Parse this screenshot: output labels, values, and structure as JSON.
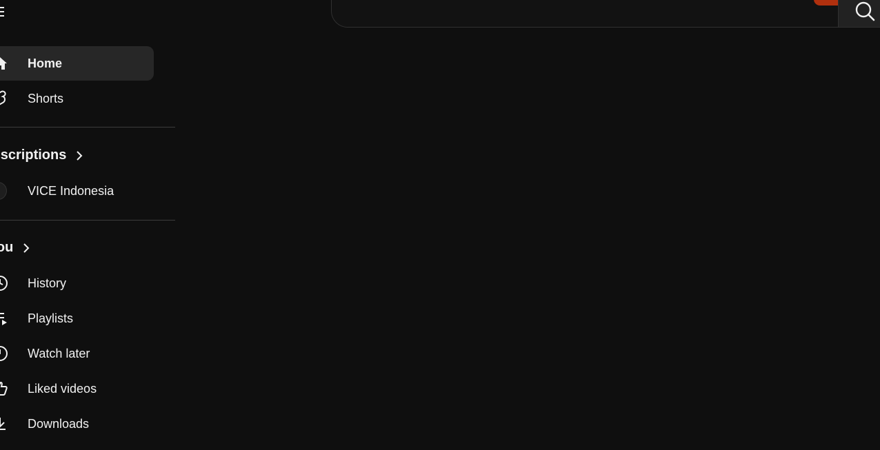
{
  "header": {
    "menu_icon": "menu-icon",
    "search_placeholder": "",
    "search_icon": "search-icon"
  },
  "colors": {
    "background": "#0f0f0f",
    "active_item": "#272727",
    "accent": "#b0300e",
    "divider": "#3d3d3d"
  },
  "sidebar": {
    "main": [
      {
        "label": "Home",
        "icon": "home-icon",
        "active": true
      },
      {
        "label": "Shorts",
        "icon": "shorts-icon",
        "active": false
      }
    ],
    "subscriptions": {
      "title": "Subscriptions",
      "channels": [
        {
          "label": "VICE Indonesia",
          "icon": "channel-avatar"
        }
      ]
    },
    "you": {
      "title": "You",
      "items": [
        {
          "label": "History",
          "icon": "history-icon"
        },
        {
          "label": "Playlists",
          "icon": "playlists-icon"
        },
        {
          "label": "Watch later",
          "icon": "watch-later-icon"
        },
        {
          "label": "Liked videos",
          "icon": "thumbs-up-icon"
        },
        {
          "label": "Downloads",
          "icon": "download-icon"
        }
      ]
    }
  }
}
